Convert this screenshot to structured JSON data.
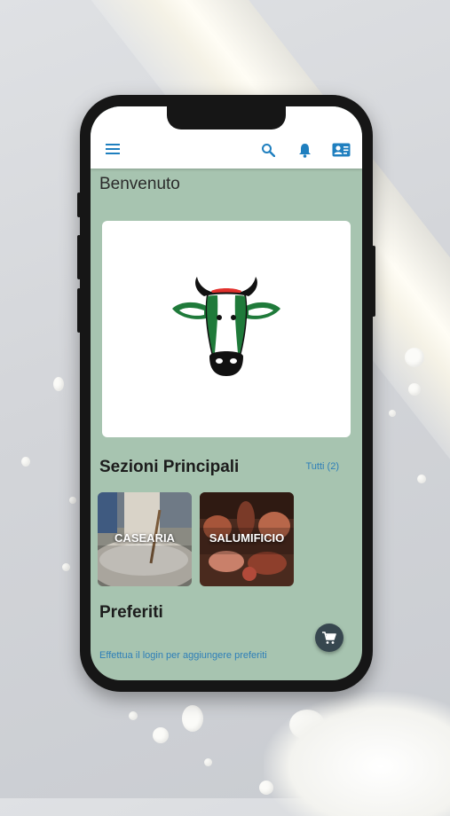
{
  "header": {
    "menu_icon": "menu-icon",
    "search_icon": "search-icon",
    "notifications_icon": "bell-icon",
    "contact_icon": "contact-card-icon"
  },
  "welcome": "Benvenuto",
  "sections": {
    "title": "Sezioni Principali",
    "see_all": "Tutti (2)",
    "items": [
      {
        "label": "CASEARIA"
      },
      {
        "label": "SALUMIFICIO"
      }
    ]
  },
  "favorites": {
    "title": "Preferiti",
    "message": "Effettua il login per aggiungere preferiti"
  },
  "fab": {
    "icon": "cart-icon"
  },
  "colors": {
    "screen_bg": "#a7c4b0",
    "accent_link": "#2e7fb8",
    "appbar_icon": "#1f7fbf",
    "fab_bg": "#37474f"
  }
}
